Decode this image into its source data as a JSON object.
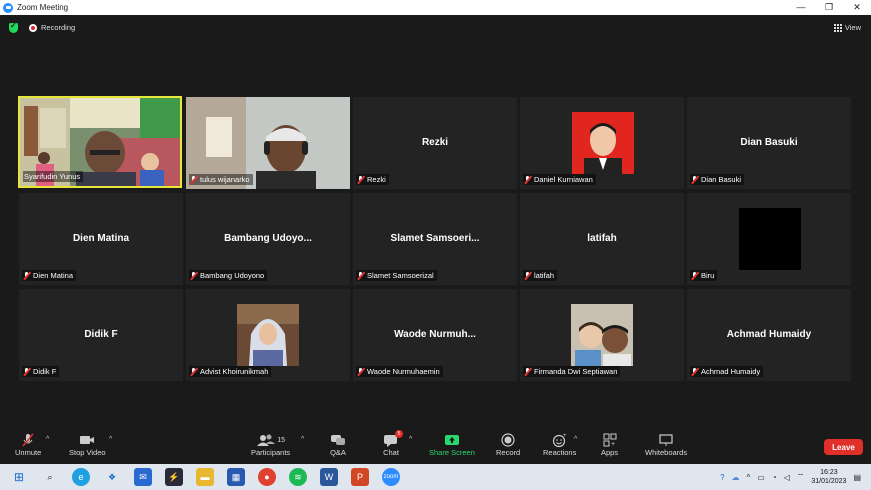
{
  "window": {
    "title": "Zoom Meeting",
    "minimize": "—",
    "maximize": "❐",
    "close": "✕"
  },
  "topbar": {
    "recording_label": "Recording",
    "view_label": "View"
  },
  "participants": [
    {
      "name": "Syarifudin Yunus",
      "center_name": "",
      "muted": false
    },
    {
      "name": "tulus wijanarko",
      "center_name": "",
      "muted": true
    },
    {
      "name": "Rezki",
      "center_name": "Rezki",
      "muted": true
    },
    {
      "name": "Daniel Kurniawan",
      "center_name": "",
      "muted": true
    },
    {
      "name": "Dian Basuki",
      "center_name": "Dian Basuki",
      "muted": true
    },
    {
      "name": "Dien Matina",
      "center_name": "Dien Matina",
      "muted": true
    },
    {
      "name": "Bambang Udoyono",
      "center_name": "Bambang  Udoyo...",
      "muted": true
    },
    {
      "name": "Slamet Samsoerizal",
      "center_name": "Slamet  Samsoeri...",
      "muted": true
    },
    {
      "name": "latifah",
      "center_name": "latifah",
      "muted": true
    },
    {
      "name": "Biru",
      "center_name": "",
      "muted": true
    },
    {
      "name": "Didik F",
      "center_name": "Didik F",
      "muted": true
    },
    {
      "name": "Advist Khoirunikmah",
      "center_name": "",
      "muted": true
    },
    {
      "name": "Waode Nurmuhaemin",
      "center_name": "Waode  Nurmuh...",
      "muted": true
    },
    {
      "name": "Firmanda Dwi Septiawan",
      "center_name": "",
      "muted": true
    },
    {
      "name": "Achmad Humaidy",
      "center_name": "Achmad Humaidy",
      "muted": true
    }
  ],
  "toolbar": {
    "unmute": "Unmute",
    "stop_video": "Stop Video",
    "participants": "Participants",
    "participants_count": "15",
    "qa": "Q&A",
    "chat": "Chat",
    "chat_badge": "5",
    "share_screen": "Share Screen",
    "record": "Record",
    "reactions": "Reactions",
    "apps": "Apps",
    "whiteboards": "Whiteboards",
    "leave": "Leave"
  },
  "taskbar": {
    "time": "16:23",
    "date": "31/01/2023"
  },
  "colors": {
    "active_border": "#e5e53a",
    "leave": "#e0302c",
    "share": "#28d86c",
    "tile_bg": "#232323"
  }
}
